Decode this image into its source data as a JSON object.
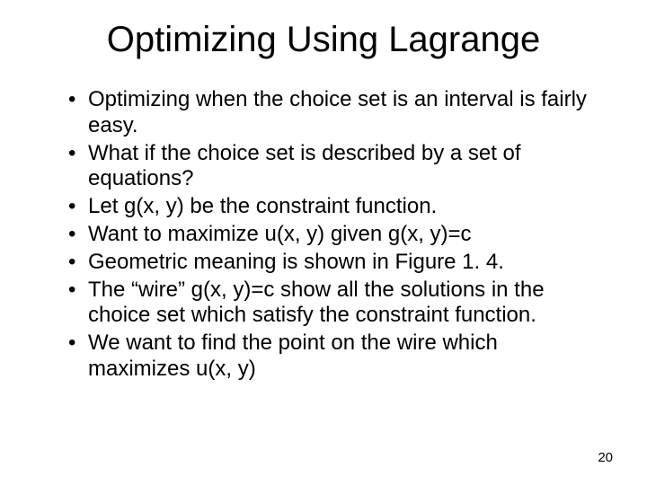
{
  "title": "Optimizing Using Lagrange",
  "bullets": [
    "Optimizing when the choice set is an interval is fairly easy.",
    "What if the choice set is described by a set of equations?",
    "Let g(x, y) be the constraint function.",
    "Want to maximize u(x, y) given g(x, y)=c",
    "Geometric meaning is shown in Figure 1. 4.",
    "The “wire” g(x, y)=c show all the solutions in the choice set which satisfy the constraint function.",
    "We want to find the point on the wire which maximizes u(x, y)"
  ],
  "page_number": "20"
}
